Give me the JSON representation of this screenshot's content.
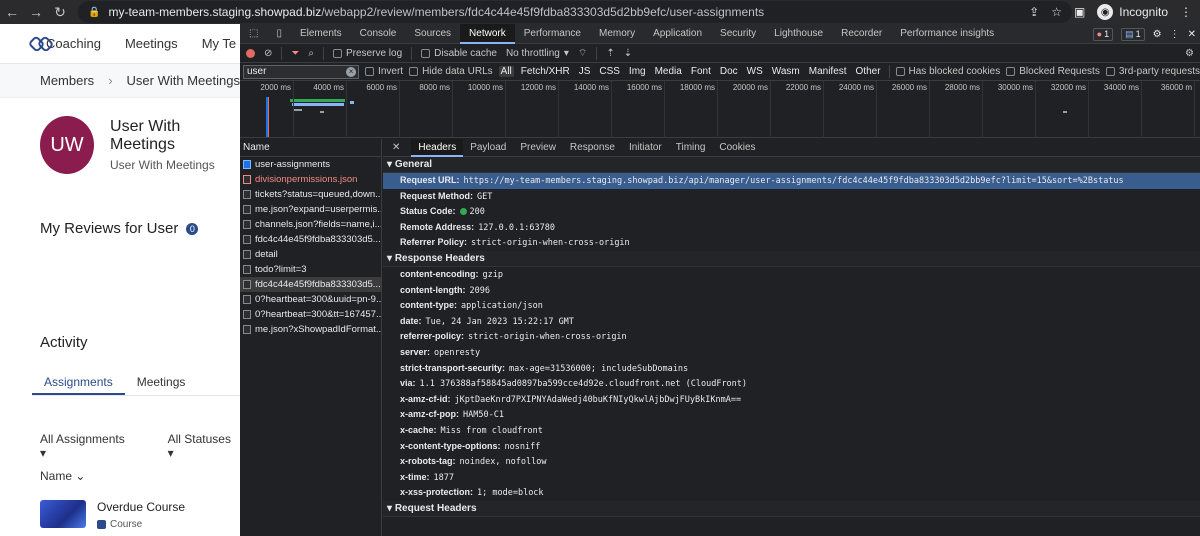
{
  "browser": {
    "url_host": "my-team-members.staging.showpad.biz",
    "url_path": "/webapp2/review/members/fdc4c44e45f9fdba833303d5d2bb9efc/user-assignments",
    "profile": "Incognito"
  },
  "app": {
    "nav": [
      "Coaching",
      "Meetings",
      "My Te"
    ],
    "breadcrumb": {
      "parent": "Members",
      "current": "User With Meetings"
    },
    "profile": {
      "initials": "UW",
      "name": "User With Meetings",
      "subtitle": "User With Meetings"
    },
    "reviews": {
      "title": "My Reviews for User",
      "count": "0"
    },
    "activity": {
      "title": "Activity",
      "tabs": [
        "Assignments",
        "Meetings"
      ],
      "filters": [
        "All Assignments",
        "All Statuses"
      ],
      "column": "Name",
      "item": {
        "title": "Overdue Course",
        "type": "Course"
      }
    }
  },
  "devtools": {
    "tabs": [
      "Elements",
      "Console",
      "Sources",
      "Network",
      "Performance",
      "Memory",
      "Application",
      "Security",
      "Lighthouse",
      "Recorder",
      "Performance insights"
    ],
    "active_tab": "Network",
    "errors": "1",
    "messages": "1",
    "toolbar": {
      "preserve_log": "Preserve log",
      "disable_cache": "Disable cache",
      "throttling": "No throttling"
    },
    "filter": {
      "value": "user",
      "invert": "Invert",
      "hide_data": "Hide data URLs",
      "types": [
        "All",
        "Fetch/XHR",
        "JS",
        "CSS",
        "Img",
        "Media",
        "Font",
        "Doc",
        "WS",
        "Wasm",
        "Manifest",
        "Other"
      ],
      "blocked_cookies": "Has blocked cookies",
      "blocked_requests": "Blocked Requests",
      "third_party": "3rd-party requests"
    },
    "timeline_ticks": [
      "2000 ms",
      "4000 ms",
      "6000 ms",
      "8000 ms",
      "10000 ms",
      "12000 ms",
      "14000 ms",
      "16000 ms",
      "18000 ms",
      "20000 ms",
      "22000 ms",
      "24000 ms",
      "26000 ms",
      "28000 ms",
      "30000 ms",
      "32000 ms",
      "34000 ms",
      "36000 m"
    ],
    "list_header": "Name",
    "requests": [
      {
        "name": "user-assignments",
        "type": "doc"
      },
      {
        "name": "divisionpermissions.json",
        "type": "err"
      },
      {
        "name": "tickets?status=queued,down...",
        "type": "xhr"
      },
      {
        "name": "me.json?expand=userpermis...",
        "type": "xhr"
      },
      {
        "name": "channels.json?fields=name,i...",
        "type": "xhr"
      },
      {
        "name": "fdc4c44e45f9fdba833303d5...",
        "type": "xhr"
      },
      {
        "name": "detail",
        "type": "xhr"
      },
      {
        "name": "todo?limit=3",
        "type": "xhr"
      },
      {
        "name": "fdc4c44e45f9fdba833303d5...",
        "type": "sel"
      },
      {
        "name": "0?heartbeat=300&uuid=pn-9...",
        "type": "xhr"
      },
      {
        "name": "0?heartbeat=300&tt=167457...",
        "type": "xhr"
      },
      {
        "name": "me.json?xShowpadIdFormat...",
        "type": "xhr"
      }
    ],
    "detail_tabs": [
      "Headers",
      "Payload",
      "Preview",
      "Response",
      "Initiator",
      "Timing",
      "Cookies"
    ],
    "general": {
      "title": "General",
      "rows": [
        {
          "k": "Request URL:",
          "v": "https://my-team-members.staging.showpad.biz/api/manager/user-assignments/fdc4c44e45f9fdba833303d5d2bb9efc?limit=15&sort=%2Bstatus"
        },
        {
          "k": "Request Method:",
          "v": "GET"
        },
        {
          "k": "Status Code:",
          "v": "200"
        },
        {
          "k": "Remote Address:",
          "v": "127.0.0.1:63780"
        },
        {
          "k": "Referrer Policy:",
          "v": "strict-origin-when-cross-origin"
        }
      ]
    },
    "response_headers": {
      "title": "Response Headers",
      "rows": [
        {
          "k": "content-encoding:",
          "v": "gzip"
        },
        {
          "k": "content-length:",
          "v": "2096"
        },
        {
          "k": "content-type:",
          "v": "application/json"
        },
        {
          "k": "date:",
          "v": "Tue, 24 Jan 2023 15:22:17 GMT"
        },
        {
          "k": "referrer-policy:",
          "v": "strict-origin-when-cross-origin"
        },
        {
          "k": "server:",
          "v": "openresty"
        },
        {
          "k": "strict-transport-security:",
          "v": "max-age=31536000; includeSubDomains"
        },
        {
          "k": "via:",
          "v": "1.1 376388af58845ad0897ba599cce4d92e.cloudfront.net (CloudFront)"
        },
        {
          "k": "x-amz-cf-id:",
          "v": "jKptDaeKnrd7PXIPNYAdaWedj40buKfNIyQkwlAjbDwjFUyBkIKnmA=="
        },
        {
          "k": "x-amz-cf-pop:",
          "v": "HAM50-C1"
        },
        {
          "k": "x-cache:",
          "v": "Miss from cloudfront"
        },
        {
          "k": "x-content-type-options:",
          "v": "nosniff"
        },
        {
          "k": "x-robots-tag:",
          "v": "noindex, nofollow"
        },
        {
          "k": "x-time:",
          "v": "1877"
        },
        {
          "k": "x-xss-protection:",
          "v": "1; mode=block"
        }
      ]
    },
    "request_headers_title": "Request Headers"
  }
}
